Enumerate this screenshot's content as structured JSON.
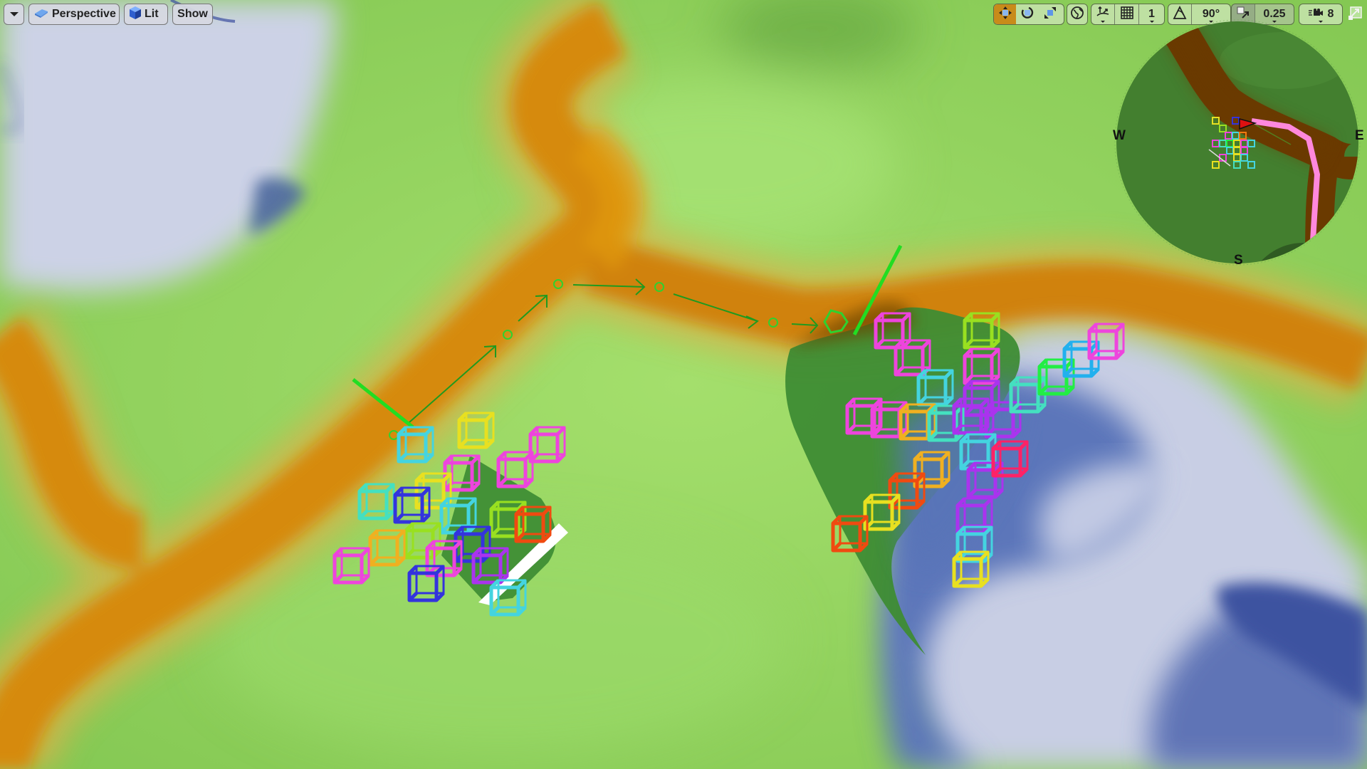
{
  "viewport": {
    "options_menu_icon": "dropdown-triangle-icon",
    "view_mode": {
      "label": "Perspective",
      "icon": "perspective-camera-icon"
    },
    "lighting_mode": {
      "label": "Lit",
      "icon": "lit-cube-icon"
    },
    "show_menu": {
      "label": "Show"
    }
  },
  "toolbar_right": {
    "transform_tools": [
      {
        "name": "translate",
        "icon": "translate-arrows-icon",
        "active": true
      },
      {
        "name": "rotate",
        "icon": "rotate-icon",
        "active": false
      },
      {
        "name": "scale",
        "icon": "scale-icon",
        "active": false
      }
    ],
    "coordinate_system": {
      "icon": "world-globe-icon"
    },
    "surface_snapping": {
      "icon": "surface-snap-icon"
    },
    "grid_snap": {
      "icon": "grid-icon",
      "value": "1"
    },
    "rotation_snap": {
      "icon": "angle-icon",
      "value": "90°"
    },
    "scale_snap": {
      "icon": "scale-snap-icon",
      "value": "0.25"
    },
    "camera_speed": {
      "icon": "camera-speed-icon",
      "value": "8"
    },
    "maximize": {
      "icon": "maximize-viewport-icon"
    }
  },
  "minimap": {
    "compass": {
      "west": "W",
      "east": "E",
      "south": "S"
    },
    "path_color": "#ff88dd",
    "player_color": "#dd1111",
    "road_color": "#6a3a00",
    "ground_color": "#3f7d2c"
  },
  "scene": {
    "colors": {
      "grass": "#8ccf57",
      "grass_light": "#a6e070",
      "road": "#d48a0a",
      "road_dark": "#b86f00",
      "snow": "#ccd2e6",
      "water": "#5a72b8",
      "water_deep": "#3f55a0",
      "forest": "#3e8c34",
      "path_arrows": "#22aa22"
    }
  }
}
